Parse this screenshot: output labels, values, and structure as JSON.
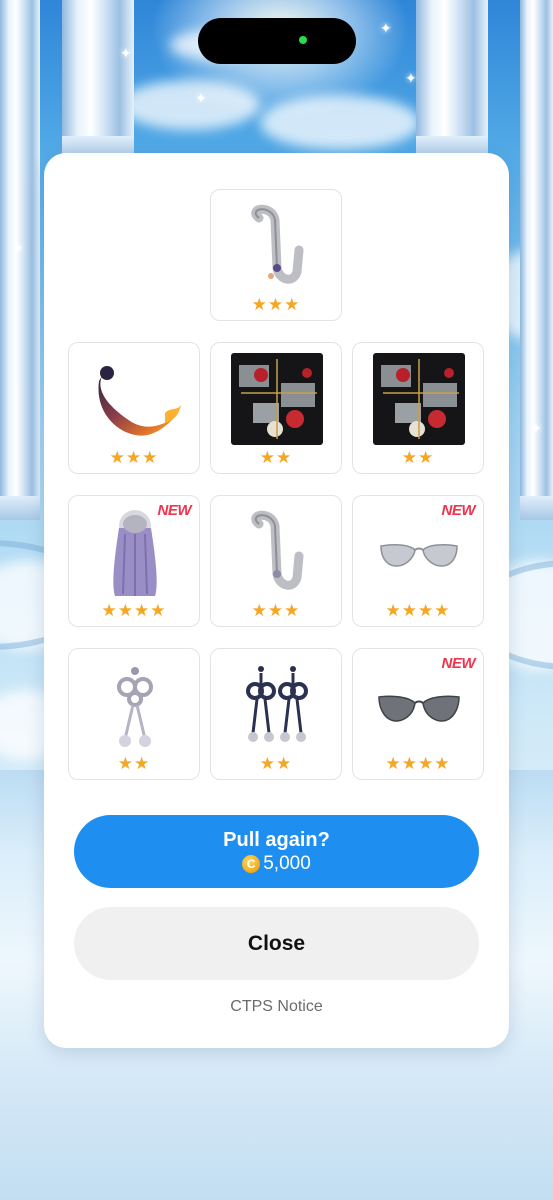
{
  "items": [
    {
      "name": "tail-curl-accessory",
      "stars": "★★★",
      "is_new": false
    },
    {
      "name": "flame-tail-accessory",
      "stars": "★★★",
      "is_new": false
    },
    {
      "name": "floral-pattern-backdrop",
      "stars": "★★",
      "is_new": false
    },
    {
      "name": "floral-pattern-backdrop-2",
      "stars": "★★",
      "is_new": false
    },
    {
      "name": "long-purple-hair",
      "stars": "★★★★",
      "is_new": true,
      "new_label": "NEW"
    },
    {
      "name": "tail-curl-accessory-2",
      "stars": "★★★",
      "is_new": false
    },
    {
      "name": "silver-cat-eye-mask",
      "stars": "★★★★",
      "is_new": true,
      "new_label": "NEW"
    },
    {
      "name": "knot-earrings-silver",
      "stars": "★★",
      "is_new": false
    },
    {
      "name": "knot-earrings-navy",
      "stars": "★★",
      "is_new": false
    },
    {
      "name": "dark-cat-eye-mask",
      "stars": "★★★★",
      "is_new": true,
      "new_label": "NEW"
    }
  ],
  "pull_button": {
    "label": "Pull again?",
    "coin_glyph": "C",
    "price": "5,000"
  },
  "close_button": {
    "label": "Close"
  },
  "notice_link": {
    "label": "CTPS Notice"
  },
  "colors": {
    "accent": "#1f8ef1",
    "stars": "#f5a623",
    "new_badge": "#f0344d"
  }
}
